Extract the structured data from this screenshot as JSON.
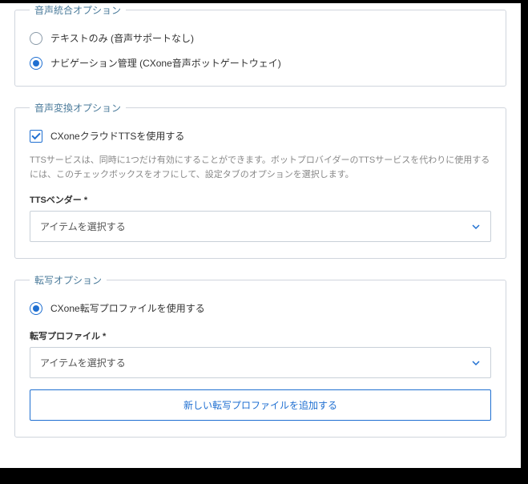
{
  "voiceIntegration": {
    "legend": "音声統合オプション",
    "options": [
      {
        "label": "テキストのみ (音声サポートなし)",
        "checked": false
      },
      {
        "label": "ナビゲーション管理 (CXone音声ボットゲートウェイ)",
        "checked": true
      }
    ]
  },
  "voiceConversion": {
    "legend": "音声変換オプション",
    "checkbox": {
      "label": "CXoneクラウドTTSを使用する",
      "checked": true
    },
    "helpText": "TTSサービスは、同時に1つだけ有効にすることができます。ボットプロバイダーのTTSサービスを代わりに使用するには、このチェックボックスをオフにして、設定タブのオプションを選択します。",
    "vendorField": {
      "label": "TTSベンダー *",
      "placeholder": "アイテムを選択する"
    }
  },
  "transcription": {
    "legend": "転写オプション",
    "radio": {
      "label": "CXone転写プロファイルを使用する",
      "checked": true
    },
    "profileField": {
      "label": "転写プロファイル *",
      "placeholder": "アイテムを選択する"
    },
    "addButton": "新しい転写プロファイルを追加する"
  }
}
